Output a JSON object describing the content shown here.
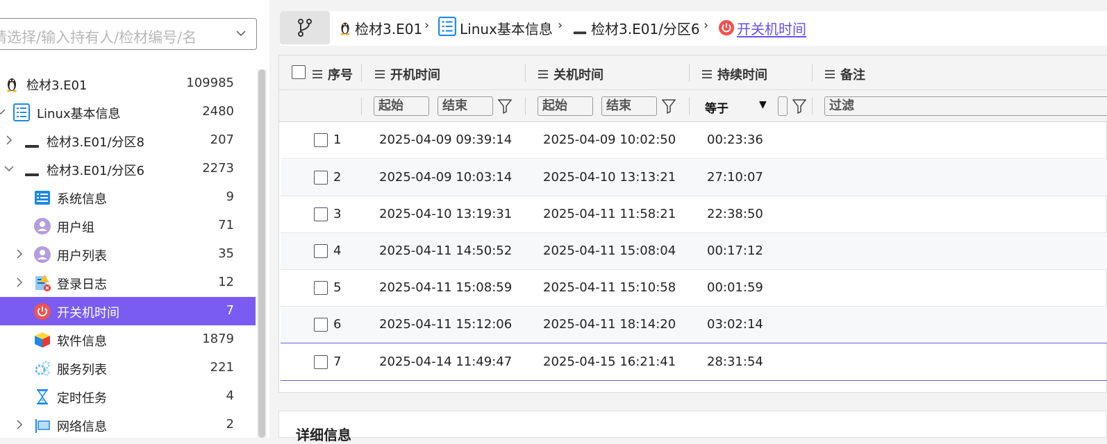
{
  "search": {
    "placeholder": "请选择/输入持有人/检材编号/名"
  },
  "tree": [
    {
      "label": "检材3.E01",
      "count": "109985",
      "icon": "linux-penguin-icon"
    },
    {
      "label": "Linux基本信息",
      "count": "2480",
      "icon": "list-icon"
    },
    {
      "label": "检材3.E01/分区8",
      "count": "207",
      "icon": "disk-icon"
    },
    {
      "label": "检材3.E01/分区6",
      "count": "2273",
      "icon": "disk-icon"
    },
    {
      "label": "系统信息",
      "count": "9",
      "icon": "system-info-icon"
    },
    {
      "label": "用户组",
      "count": "71",
      "icon": "user-group-icon"
    },
    {
      "label": "用户列表",
      "count": "35",
      "icon": "user-list-icon"
    },
    {
      "label": "登录日志",
      "count": "12",
      "icon": "login-log-icon"
    },
    {
      "label": "开关机时间",
      "count": "7",
      "icon": "power-icon"
    },
    {
      "label": "软件信息",
      "count": "1879",
      "icon": "software-cube-icon"
    },
    {
      "label": "服务列表",
      "count": "221",
      "icon": "services-gear-icon"
    },
    {
      "label": "定时任务",
      "count": "4",
      "icon": "hourglass-icon"
    },
    {
      "label": "网络信息",
      "count": "2",
      "icon": "network-icon"
    }
  ],
  "breadcrumb": [
    {
      "label": "检材3.E01",
      "icon": "linux-penguin-icon"
    },
    {
      "label": "Linux基本信息",
      "icon": "list-icon"
    },
    {
      "label": "检材3.E01/分区6",
      "icon": "disk-icon"
    },
    {
      "label": "开关机时间",
      "icon": "power-icon"
    }
  ],
  "table": {
    "columns": [
      "序号",
      "开机时间",
      "关机时间",
      "持续时间",
      "备注"
    ],
    "filters": {
      "boot_start": "起始",
      "boot_end": "结束",
      "shutdown_start": "起始",
      "shutdown_end": "结束",
      "duration_op": "等于",
      "duration_op_arrow": "▼",
      "note": "过滤"
    },
    "rows": [
      {
        "no": "1",
        "boot": "2025-04-09 09:39:14",
        "shutdown": "2025-04-09 10:02:50",
        "duration": "00:23:36",
        "note": ""
      },
      {
        "no": "2",
        "boot": "2025-04-09 10:03:14",
        "shutdown": "2025-04-10 13:13:21",
        "duration": "27:10:07",
        "note": ""
      },
      {
        "no": "3",
        "boot": "2025-04-10 13:19:31",
        "shutdown": "2025-04-11 11:58:21",
        "duration": "22:38:50",
        "note": ""
      },
      {
        "no": "4",
        "boot": "2025-04-11 14:50:52",
        "shutdown": "2025-04-11 15:08:04",
        "duration": "00:17:12",
        "note": ""
      },
      {
        "no": "5",
        "boot": "2025-04-11 15:08:59",
        "shutdown": "2025-04-11 15:10:58",
        "duration": "00:01:59",
        "note": ""
      },
      {
        "no": "6",
        "boot": "2025-04-11 15:12:06",
        "shutdown": "2025-04-11 18:14:20",
        "duration": "03:02:14",
        "note": ""
      },
      {
        "no": "7",
        "boot": "2025-04-14 11:49:47",
        "shutdown": "2025-04-15 16:21:41",
        "duration": "28:31:54",
        "note": ""
      }
    ]
  },
  "details": {
    "title": "详细信息"
  },
  "colors": {
    "accent": "#7b5cf3",
    "link": "#6a4ef0",
    "power": "#ef5350"
  }
}
